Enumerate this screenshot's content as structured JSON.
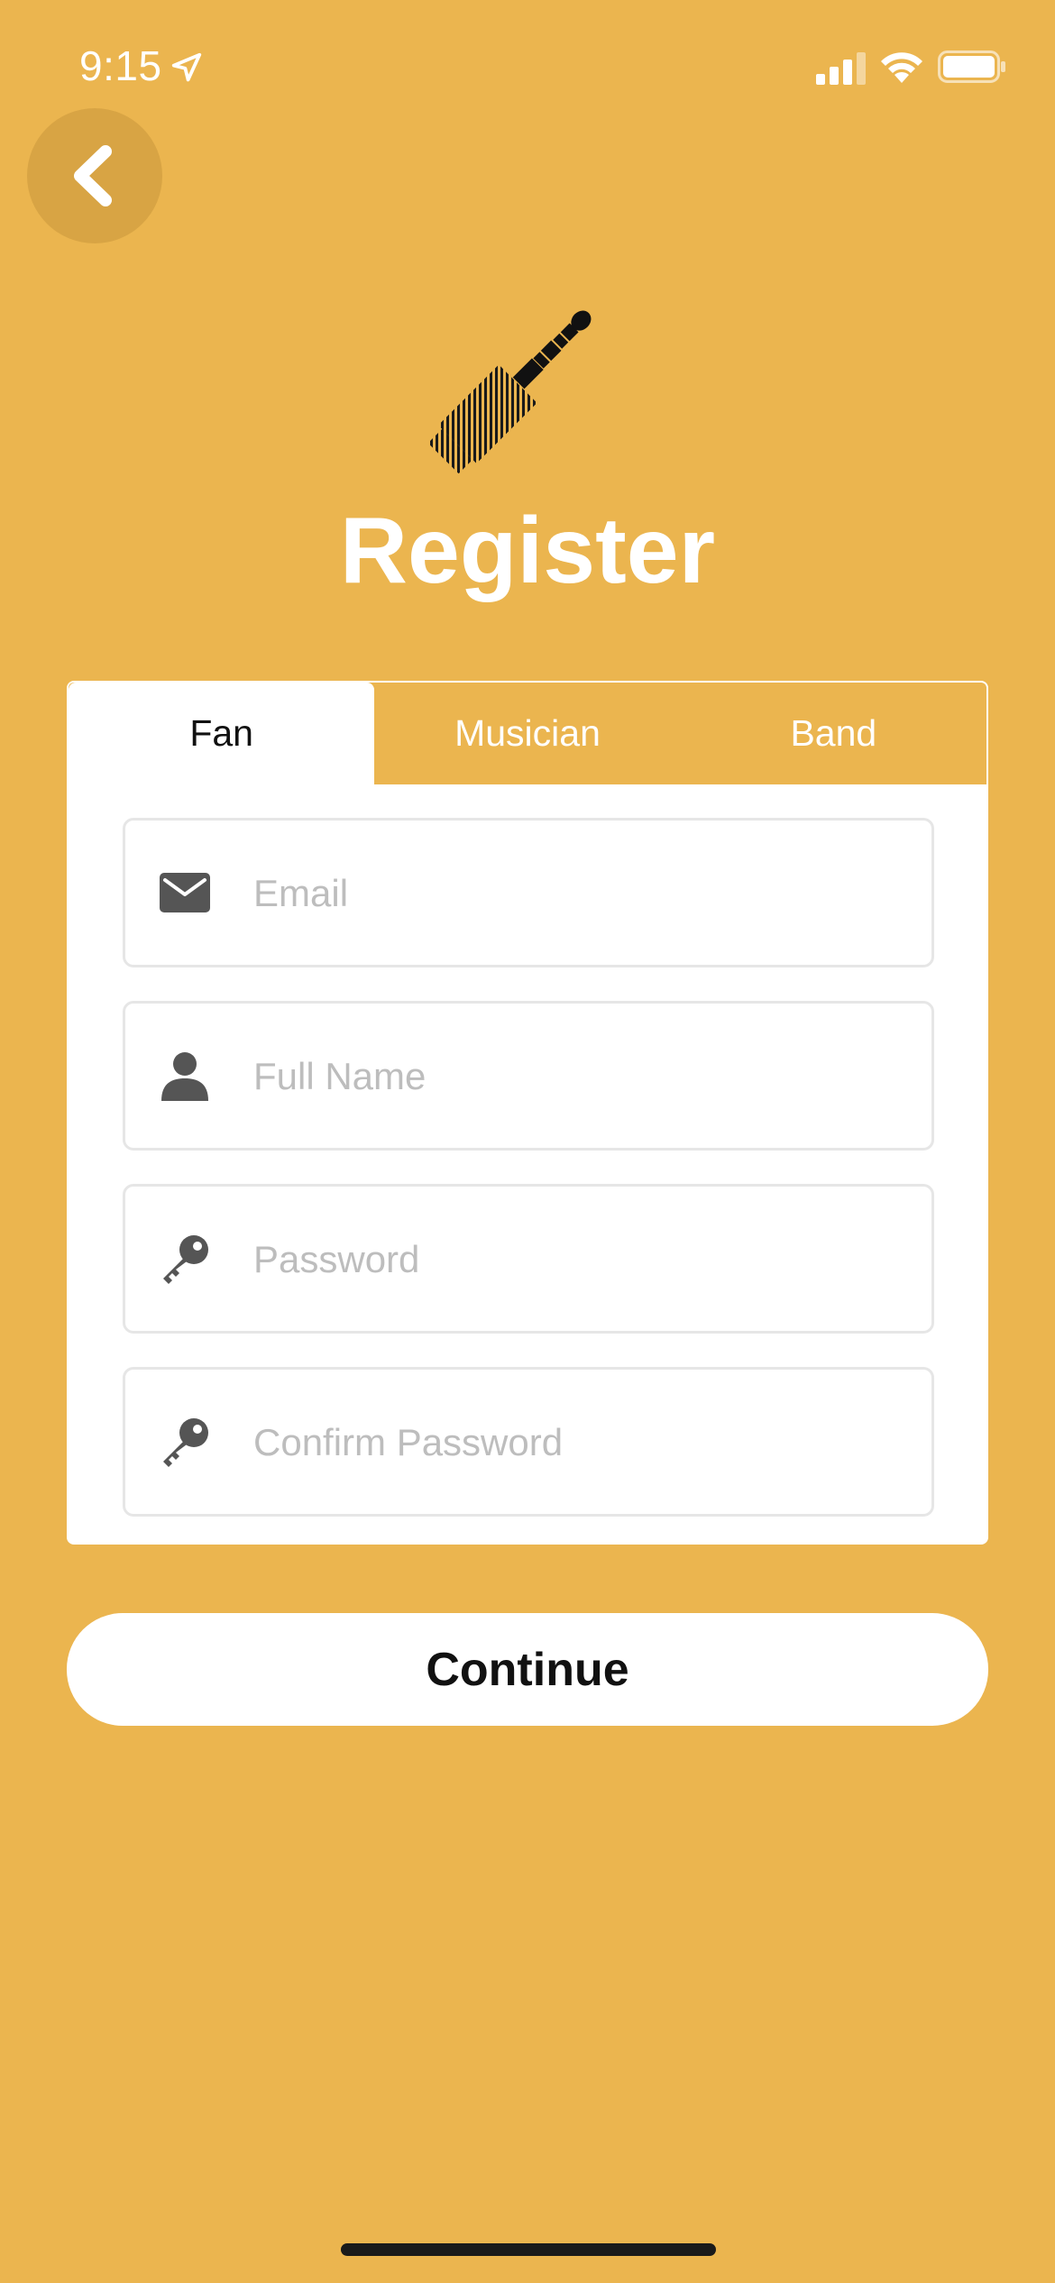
{
  "status_bar": {
    "time": "9:15"
  },
  "header": {
    "title": "Register",
    "logo_icon": "audio-jack-icon",
    "back_icon": "chevron-left-icon"
  },
  "tabs": [
    {
      "label": "Fan",
      "active": true
    },
    {
      "label": "Musician",
      "active": false
    },
    {
      "label": "Band",
      "active": false
    }
  ],
  "form": {
    "email": {
      "placeholder": "Email",
      "value": "",
      "icon": "envelope-icon"
    },
    "full_name": {
      "placeholder": "Full Name",
      "value": "",
      "icon": "person-icon"
    },
    "password": {
      "placeholder": "Password",
      "value": "",
      "icon": "key-icon"
    },
    "confirm_password": {
      "placeholder": "Confirm Password",
      "value": "",
      "icon": "key-icon"
    }
  },
  "actions": {
    "continue_label": "Continue"
  },
  "colors": {
    "background": "#EBB54F",
    "back_button": "#D8A444",
    "card": "#FFFFFF",
    "icon": "#555555",
    "placeholder": "#BDBDBD"
  }
}
